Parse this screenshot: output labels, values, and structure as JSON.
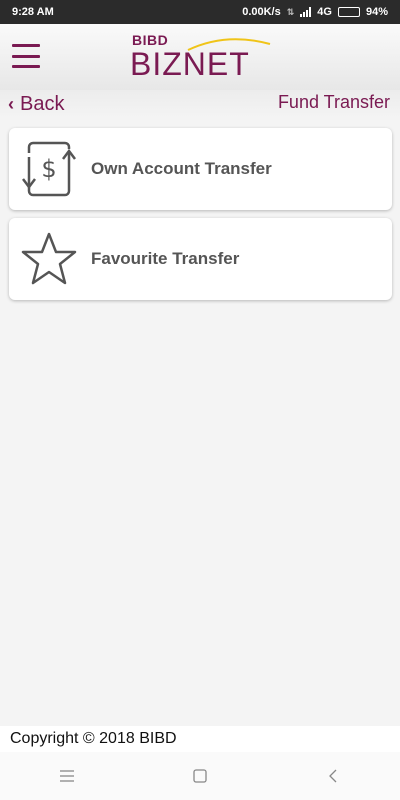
{
  "status_bar": {
    "time": "9:28 AM",
    "network_speed": "0.00K/s",
    "network_type": "4G",
    "battery": "94%",
    "battery_level": 0.94
  },
  "header": {
    "logo_top": "BIBD",
    "logo_main": "BIZNET",
    "menu_icon": "hamburger-menu-icon"
  },
  "nav": {
    "back_label": "Back",
    "title": "Fund Transfer"
  },
  "options": [
    {
      "label": "Own Account Transfer",
      "icon": "dollar-transfer-icon"
    },
    {
      "label": "Favourite Transfer",
      "icon": "star-icon"
    }
  ],
  "footer": {
    "copyright": "Copyright © 2018 BIBD"
  },
  "colors": {
    "brand": "#7a1a52",
    "accent_arc": "#f0c418",
    "card_text": "#555555"
  }
}
